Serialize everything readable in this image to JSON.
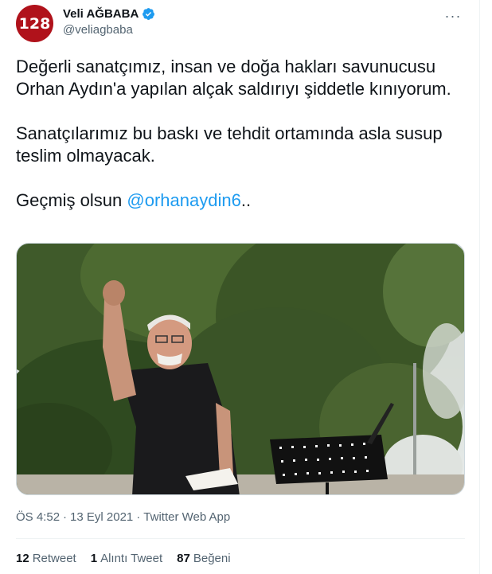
{
  "user": {
    "avatar_text": "128",
    "avatar_color": "#b0121b",
    "display_name": "Veli AĞBABA",
    "handle": "@veliagbaba",
    "verified_icon": "verified-badge-icon"
  },
  "more_icon": "···",
  "tweet": {
    "line1": "Değerli sanatçımız, insan ve doğa hakları savunucusu Orhan Aydın'a yapılan alçak saldırıyı şiddetle kınıyorum.",
    "line2": "Sanatçılarımız bu baskı ve tehdit ortamında asla susup teslim olmayacak.",
    "line3_prefix": "Geçmiş olsun ",
    "mention": "@orhanaydin6",
    "line3_suffix": ".."
  },
  "meta": {
    "time": "ÖS 4:52",
    "sep1": "·",
    "date": "13 Eyl 2021",
    "sep2": "·",
    "source": "Twitter Web App"
  },
  "stats": {
    "retweets_count": "12",
    "retweets_label": "Retweet",
    "quotes_count": "1",
    "quotes_label": "Alıntı Tweet",
    "likes_count": "87",
    "likes_label": "Beğeni"
  },
  "colors": {
    "link": "#1d9bf0",
    "secondary_text": "#536471",
    "primary_text": "#0f1419"
  }
}
